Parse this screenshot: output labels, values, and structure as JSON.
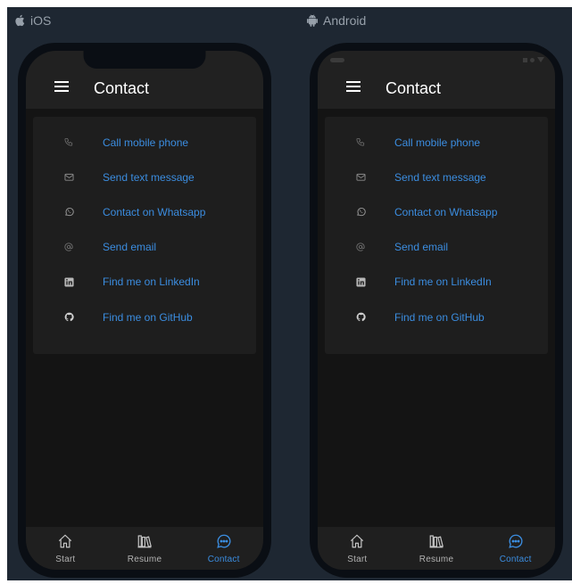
{
  "platforms": {
    "ios_label": "iOS",
    "android_label": "Android"
  },
  "screen": {
    "title": "Contact",
    "menu_icon": "hamburger-menu-icon"
  },
  "contact_items": [
    {
      "label": "Call mobile phone",
      "icon": "phone-icon"
    },
    {
      "label": "Send text message",
      "icon": "message-icon"
    },
    {
      "label": "Contact on Whatsapp",
      "icon": "whatsapp-icon"
    },
    {
      "label": "Send email",
      "icon": "at-sign-icon"
    },
    {
      "label": "Find me on LinkedIn",
      "icon": "linkedin-icon"
    },
    {
      "label": "Find me on GitHub",
      "icon": "github-icon"
    }
  ],
  "tabs": [
    {
      "label": "Start",
      "icon": "home-icon",
      "active": false
    },
    {
      "label": "Resume",
      "icon": "library-icon",
      "active": false
    },
    {
      "label": "Contact",
      "icon": "chat-bubble-icon",
      "active": true
    }
  ],
  "colors": {
    "accent": "#3b8de0",
    "stage_background": "#1e2732",
    "appbar": "#212121",
    "card": "#1e1e1e",
    "screen_background": "#141414"
  }
}
